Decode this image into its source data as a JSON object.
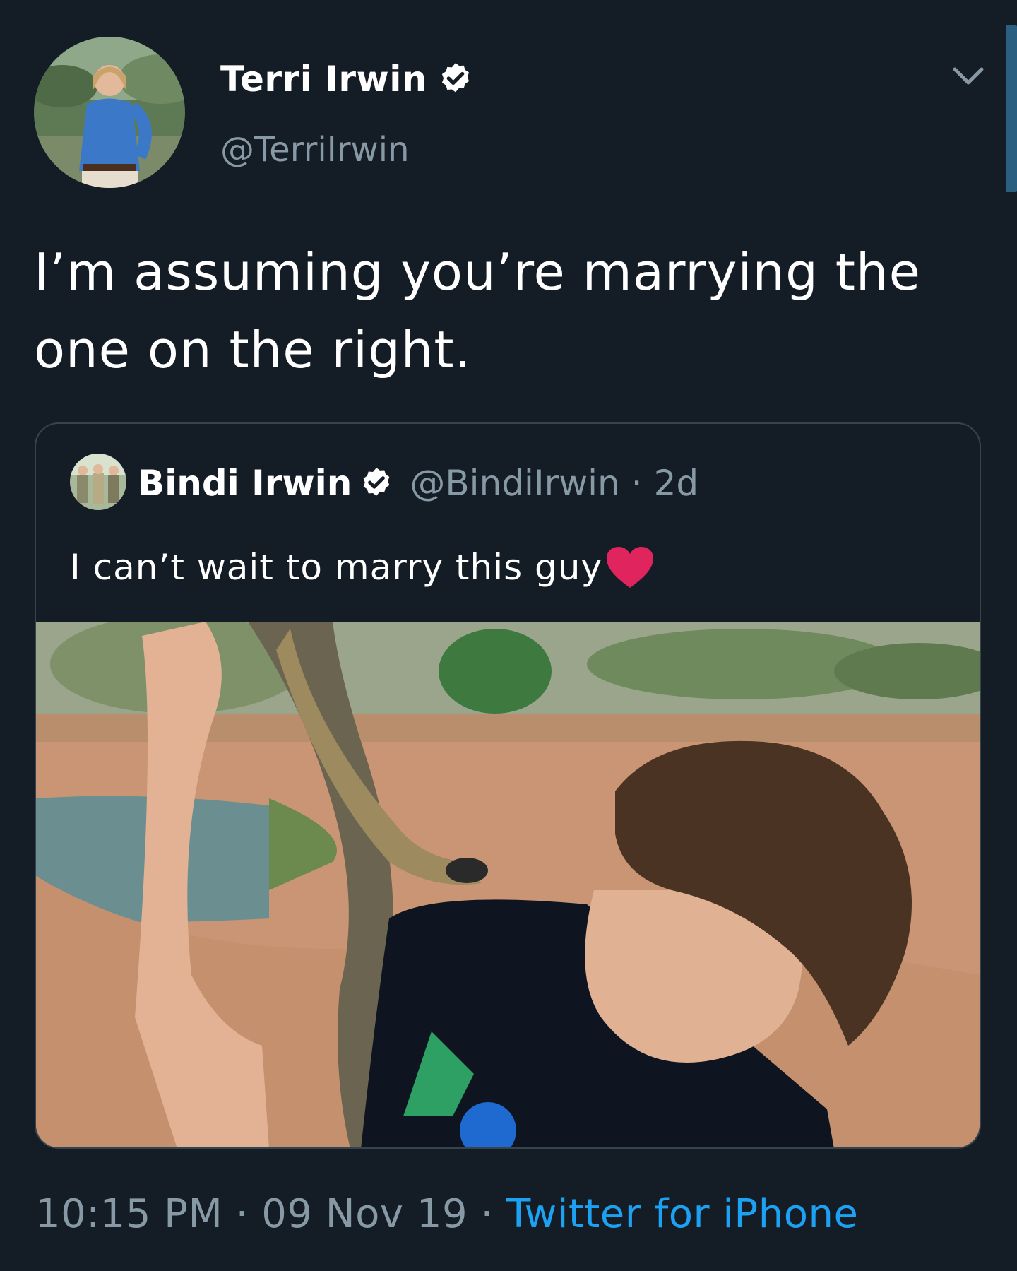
{
  "tweet": {
    "author_name": "Terri Irwin",
    "author_handle": "@TerriIrwin",
    "text_line1": "I’m assuming you’re marrying the",
    "text_line2": "one on the right.",
    "time": "10:15 PM",
    "date": "09 Nov 19",
    "source": "Twitter for iPhone",
    "separator": "·"
  },
  "quoted": {
    "author_name": "Bindi Irwin",
    "author_handle": "@BindiIrwin",
    "age": "2d",
    "separator": "·",
    "text": "I can’t wait to marry this guy"
  },
  "icons": {
    "verified": "verified-badge-icon",
    "chevron": "chevron-down-icon",
    "heart": "red-heart-emoji"
  },
  "colors": {
    "background": "#141d26",
    "secondary_text": "#8899a6",
    "link": "#1da1f2",
    "heart": "#e0245e"
  }
}
